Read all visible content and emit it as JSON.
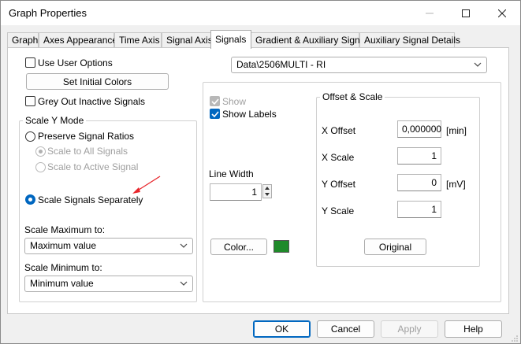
{
  "window": {
    "title": "Graph Properties"
  },
  "titlebar": {
    "minimize_icon": "minimize-icon",
    "maximize_icon": "maximize-icon",
    "close_icon": "close-icon"
  },
  "tabs": [
    {
      "label": "Graph"
    },
    {
      "label": "Axes Appearance"
    },
    {
      "label": "Time Axis"
    },
    {
      "label": "Signal Axis"
    },
    {
      "label": "Signals",
      "active": true
    },
    {
      "label": "Gradient & Auxiliary Signals"
    },
    {
      "label": "Auxiliary Signal Details"
    }
  ],
  "left": {
    "use_user_options": {
      "label": "Use User Options",
      "checked": false
    },
    "set_initial_colors_label": "Set Initial Colors",
    "grey_out": {
      "label": "Grey Out Inactive Signals",
      "checked": false
    },
    "scale_y_mode": {
      "title": "Scale Y Mode",
      "preserve_ratios": {
        "label": "Preserve Signal Ratios",
        "checked": false
      },
      "scale_all": {
        "label": "Scale to All Signals",
        "checked": true,
        "enabled": false
      },
      "scale_active": {
        "label": "Scale to Active Signal",
        "checked": false,
        "enabled": false
      },
      "scale_separately": {
        "label": "Scale Signals Separately",
        "checked": true
      },
      "scale_max_label": "Scale Maximum to:",
      "scale_max_value": "Maximum value",
      "scale_min_label": "Scale Minimum to:",
      "scale_min_value": "Minimum value"
    }
  },
  "right": {
    "signal_select_value": "Data\\2506MULTI - RI",
    "show": {
      "label": "Show",
      "checked": true,
      "enabled": false
    },
    "show_labels": {
      "label": "Show Labels",
      "checked": true
    },
    "line_width_label": "Line Width",
    "line_width_value": "1",
    "color_button_label": "Color...",
    "color_swatch": "#1f8a2a",
    "offset_scale": {
      "title": "Offset & Scale",
      "x_offset_label": "X Offset",
      "x_offset_value": "0,000000",
      "x_offset_unit": "[min]",
      "x_scale_label": "X Scale",
      "x_scale_value": "1",
      "y_offset_label": "Y Offset",
      "y_offset_value": "0",
      "y_offset_unit": "[mV]",
      "y_scale_label": "Y Scale",
      "y_scale_value": "1",
      "original_label": "Original"
    }
  },
  "footer": {
    "ok_label": "OK",
    "cancel_label": "Cancel",
    "apply_label": "Apply",
    "help_label": "Help"
  },
  "annotation": {
    "arrow_color": "#e8252b"
  }
}
